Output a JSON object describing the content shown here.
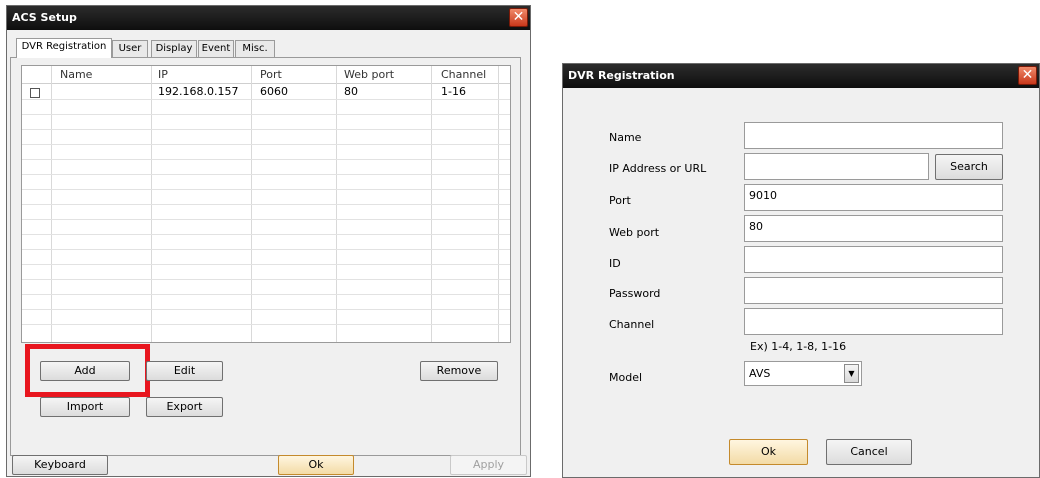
{
  "acs": {
    "title": "ACS Setup",
    "close": "✕",
    "tabs": [
      "DVR Registration",
      "User",
      "Display",
      "Event",
      "Misc."
    ],
    "columns": [
      "Name",
      "IP",
      "Port",
      "Web port",
      "Channel"
    ],
    "rows": [
      {
        "checked": false,
        "name": "",
        "ip": "192.168.0.157",
        "port": "6060",
        "web_port": "80",
        "channel": "1-16"
      }
    ],
    "buttons": {
      "add": "Add",
      "edit": "Edit",
      "remove": "Remove",
      "import": "Import",
      "export": "Export",
      "keyboard": "Keyboard",
      "ok": "Ok",
      "apply": "Apply"
    }
  },
  "dvr": {
    "title": "DVR Registration",
    "close": "✕",
    "labels": {
      "name": "Name",
      "ip": "IP Address or URL",
      "port": "Port",
      "web_port": "Web port",
      "id": "ID",
      "password": "Password",
      "channel": "Channel",
      "model": "Model"
    },
    "values": {
      "name": "",
      "ip": "",
      "port": "9010",
      "web_port": "80",
      "id": "",
      "password": "",
      "channel": "",
      "model": "AVS"
    },
    "channel_hint": "Ex) 1-4, 1-8, 1-16",
    "buttons": {
      "search": "Search",
      "ok": "Ok",
      "cancel": "Cancel"
    },
    "select_arrow": "▼"
  },
  "highlight_color": "#e8161f"
}
